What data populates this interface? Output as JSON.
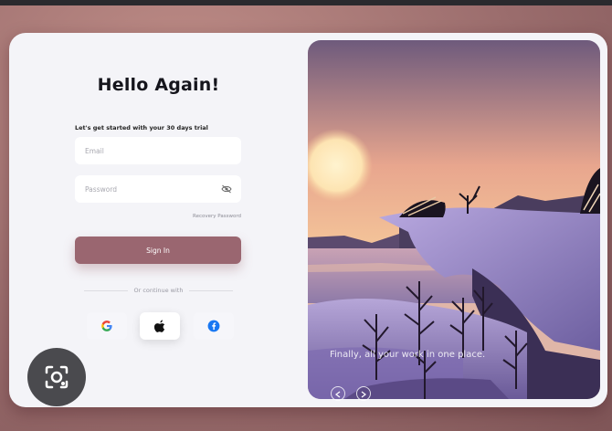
{
  "login": {
    "title": "Hello Again!",
    "subtitle": "Let's get started with your 30 days trial",
    "email_placeholder": "Email",
    "password_placeholder": "Password",
    "recovery_label": "Recovery Password",
    "signin_label": "Sign In",
    "continue_label": "Or continue with",
    "social": [
      {
        "icon": "google-icon"
      },
      {
        "icon": "apple-icon"
      },
      {
        "icon": "facebook-icon"
      }
    ]
  },
  "illustration": {
    "tagline": "Finally, all your work in one place."
  },
  "colors": {
    "accent": "#9a6670",
    "card": "#f4f4f8"
  }
}
